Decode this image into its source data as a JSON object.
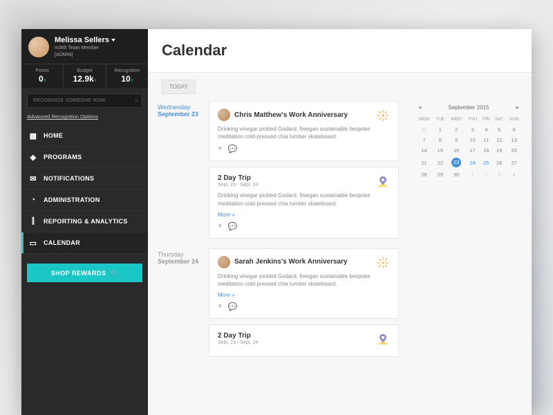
{
  "profile": {
    "name": "Melissa Sellers",
    "meta1": "m365 Team Member",
    "meta2": "[ADMIN]"
  },
  "stats": {
    "points_label": "Points",
    "points_value": "0",
    "budget_label": "Budget",
    "budget_value": "12.9k",
    "recognition_label": "Recognition",
    "recognition_value": "10"
  },
  "search": {
    "placeholder": "RECOGNIZE SOMEONE NOW"
  },
  "adv_link": "Advanced Recognition Options",
  "nav": {
    "home": "HOME",
    "programs": "PROGRAMS",
    "notifications": "NOTIFICATIONS",
    "administration": "ADMINISTRATION",
    "reporting": "REPORTING & ANALYTICS",
    "calendar": "CALENDAR"
  },
  "shop_btn": "SHOP REWARDS",
  "page_title": "Calendar",
  "today_btn": "TODAY",
  "feed": {
    "day1": {
      "dow": "Wednesday",
      "date": "September 23"
    },
    "day2": {
      "dow": "Thursday",
      "date": "September 24"
    },
    "card1": {
      "title": "Chris Matthew's Work Anniversary",
      "body": "Drinking vinegar pickled Godard, freegan sustainable bespoke meditation cold-pressed chia lumber skateboard."
    },
    "card2": {
      "title": "2 Day Trip",
      "sub": "Sept. 23 - Sept. 24",
      "body": "Drinking vinegar pickled Godard, freegan sustainable bespoke meditation cold-pressed chia lumber skateboard.",
      "more": "More »"
    },
    "card3": {
      "title": "Sarah Jenkins's Work Anniversary",
      "body": "Drinking vinegar pickled Godard, freegan sustainable bespoke meditation cold-pressed chia lumber skateboard.",
      "more": "More »"
    },
    "card4": {
      "title": "2 Day Trip",
      "sub": "Sept. 23 - Sept. 24"
    }
  },
  "calendar": {
    "month": "September 2015",
    "dow": [
      "MON",
      "TUE",
      "WED",
      "THU",
      "FRI",
      "SAT",
      "SUN"
    ],
    "rows": [
      [
        {
          "d": "31",
          "o": 1
        },
        {
          "d": "1"
        },
        {
          "d": "2"
        },
        {
          "d": "3"
        },
        {
          "d": "4"
        },
        {
          "d": "5"
        },
        {
          "d": "6"
        }
      ],
      [
        {
          "d": "7"
        },
        {
          "d": "8"
        },
        {
          "d": "9"
        },
        {
          "d": "10"
        },
        {
          "d": "11"
        },
        {
          "d": "12"
        },
        {
          "d": "13"
        }
      ],
      [
        {
          "d": "14"
        },
        {
          "d": "15"
        },
        {
          "d": "16"
        },
        {
          "d": "17"
        },
        {
          "d": "18"
        },
        {
          "d": "19"
        },
        {
          "d": "20"
        }
      ],
      [
        {
          "d": "21"
        },
        {
          "d": "22"
        },
        {
          "d": "23",
          "t": 1
        },
        {
          "d": "24",
          "s": 1
        },
        {
          "d": "25",
          "s": 1
        },
        {
          "d": "26"
        },
        {
          "d": "27"
        }
      ],
      [
        {
          "d": "28"
        },
        {
          "d": "29"
        },
        {
          "d": "30"
        },
        {
          "d": "1",
          "o": 1
        },
        {
          "d": "2",
          "o": 1
        },
        {
          "d": "3",
          "o": 1
        },
        {
          "d": "4",
          "o": 1
        }
      ]
    ]
  }
}
